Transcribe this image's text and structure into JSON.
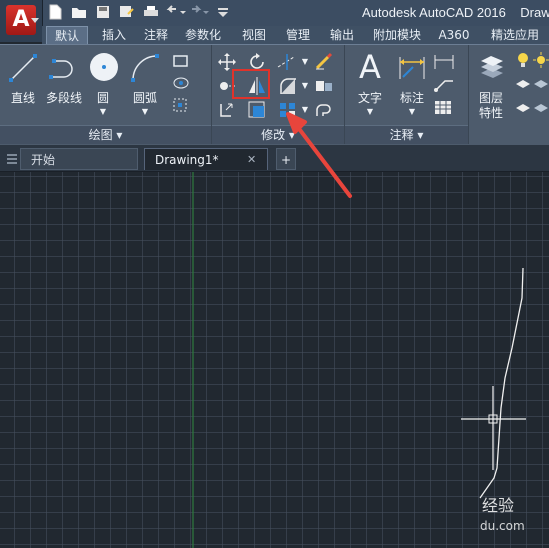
{
  "app": {
    "logo_letter": "A",
    "title": "Autodesk AutoCAD 2016",
    "title_tail": "Draw"
  },
  "qat": {
    "icons": [
      "new-icon",
      "open-icon",
      "save-icon",
      "saveas-icon",
      "print-icon",
      "undo-icon",
      "redo-icon",
      "customize-icon"
    ]
  },
  "ribbon_tabs": [
    "默认",
    "插入",
    "注释",
    "参数化",
    "视图",
    "管理",
    "输出",
    "附加模块",
    "A360",
    "精选应用"
  ],
  "active_tab": "默认",
  "panels": {
    "draw": {
      "title": "绘图",
      "tools": [
        "直线",
        "多段线",
        "圆",
        "圆弧"
      ]
    },
    "modify": {
      "title": "修改"
    },
    "annotation": {
      "title": "注释",
      "tools": [
        "文字",
        "标注"
      ]
    },
    "layers": {
      "label_line1": "图层",
      "label_line2": "特性"
    }
  },
  "doc_tabs": {
    "start": "开始",
    "drawing": "Drawing1*",
    "close": "✕",
    "add": "+"
  },
  "watermark": {
    "line1": "经验",
    "line2": "du.com"
  },
  "colors": {
    "highlight_box": "#e0332b",
    "arrow": "#e8453c",
    "accent": "#2d86d6",
    "canvas_bg": "#212830"
  }
}
